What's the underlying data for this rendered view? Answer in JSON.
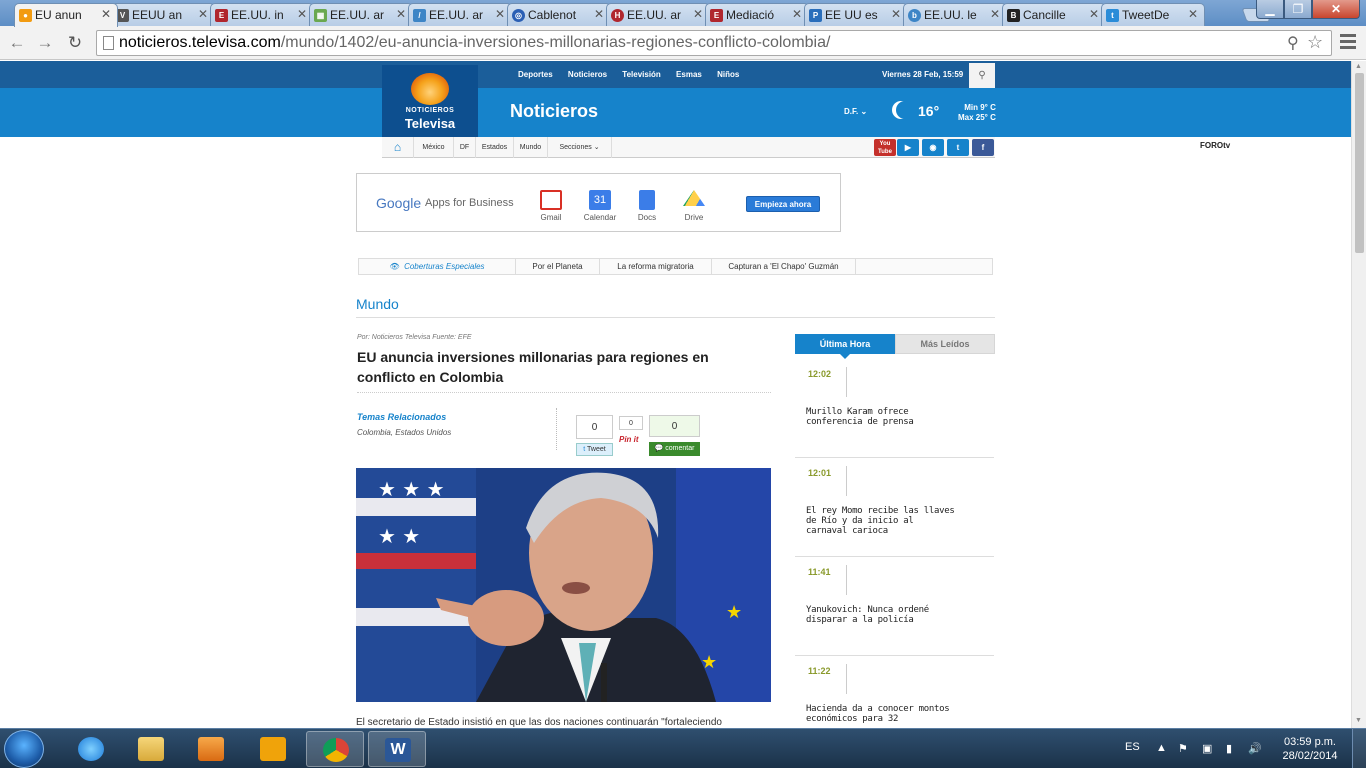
{
  "browser": {
    "tabs": [
      {
        "label": "EU anun",
        "icon": "televisa-icon",
        "color": "#f29b11",
        "active": true
      },
      {
        "label": "EEUU an",
        "icon": "vanguardia-icon",
        "color": "#555555"
      },
      {
        "label": "EE.UU. in",
        "icon": "ee-icon",
        "color": "#b0262d"
      },
      {
        "label": "EE.UU. ar",
        "icon": "map-icon",
        "color": "#6aa84f"
      },
      {
        "label": "EE.UU. ar",
        "icon": "pen-icon",
        "color": "#3d85c6"
      },
      {
        "label": "Cablenot",
        "icon": "globe-icon",
        "color": "#2b5fb4"
      },
      {
        "label": "EE.UU. ar",
        "icon": "h-icon",
        "color": "#b0262d"
      },
      {
        "label": "Mediació",
        "icon": "ee-icon",
        "color": "#b0262d"
      },
      {
        "label": "EE UU es",
        "icon": "p-icon",
        "color": "#2a6ebb"
      },
      {
        "label": "EE.UU. le",
        "icon": "bb-icon",
        "color": "#3d85c6"
      },
      {
        "label": "Cancille",
        "icon": "bbc-icon",
        "color": "#222222"
      },
      {
        "label": "TweetDe",
        "icon": "twitter-icon",
        "color": "#2a8cd8"
      }
    ],
    "url_host": "noticieros.televisa.com",
    "url_path": "/mundo/1402/eu-anuncia-inversiones-millonarias-regiones-conflicto-colombia/"
  },
  "site": {
    "logo_top": "NOTICIEROS",
    "logo_main": "Televisa",
    "topnav": [
      "Deportes",
      "Noticieros",
      "Televisión",
      "Esmas",
      "Niños"
    ],
    "datetime": "Viernes 28 Feb, 15:59",
    "section_title": "Noticieros",
    "region": "D.F.",
    "temp": "16°",
    "min": "Min 9° C",
    "max": "Max 25° C",
    "subnav": [
      "México",
      "DF",
      "Estados",
      "Mundo",
      "Secciones"
    ],
    "forotv": "FOROtv",
    "youtube": "You Tube"
  },
  "ad": {
    "brand": "Google",
    "product": "Apps for Business",
    "apps": [
      "Gmail",
      "Calendar",
      "Docs",
      "Drive"
    ],
    "calendar_day": "31",
    "cta": "Empieza ahora"
  },
  "coverage": {
    "label": "Coberturas Especiales",
    "items": [
      "Por el Planeta",
      "La reforma migratoria",
      "Capturan a 'El Chapo' Guzmán"
    ]
  },
  "section": "Mundo",
  "article": {
    "byline": "Por: Noticieros Televisa    Fuente: EFE",
    "headline": "EU anuncia inversiones millonarias para regiones en conflicto en Colombia",
    "related_label": "Temas Relacionados",
    "related_values": "Colombia, Estados Unidos",
    "tweet_count": "0",
    "tweet_label": "Tweet",
    "pin_count": "0",
    "pin_label": "Pin it",
    "comment_count": "0",
    "comment_label": "comentar",
    "body": "El secretario de Estado insistió en que las dos naciones continuarán \"fortaleciendo"
  },
  "sidebar": {
    "tab_latest": "Última Hora",
    "tab_popular": "Más Leídos",
    "news": [
      {
        "time": "12:02",
        "text": "Murillo Karam ofrece conferencia de prensa"
      },
      {
        "time": "12:01",
        "text": "El rey Momo recibe las llaves de Río y da inicio al carnaval carioca"
      },
      {
        "time": "11:41",
        "text": "Yanukovich: Nunca ordené disparar a la policía"
      },
      {
        "time": "11:22",
        "text": "Hacienda da a conocer montos económicos para 32"
      }
    ]
  },
  "taskbar": {
    "lang": "ES",
    "time": "03:59 p.m.",
    "date": "28/02/2014"
  }
}
